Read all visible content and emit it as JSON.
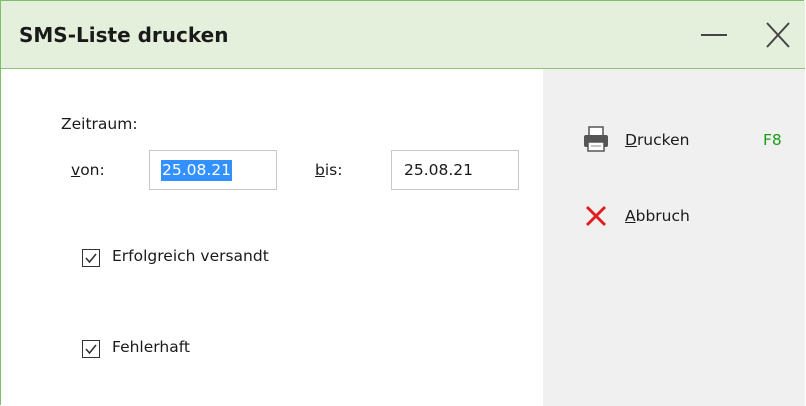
{
  "window": {
    "title": "SMS-Liste drucken",
    "controls": {
      "minimize": "minimize-icon",
      "close": "close-icon"
    }
  },
  "zeitraum": {
    "heading": "Zeitraum:",
    "from": {
      "label_accel": "v",
      "label_rest": "on:",
      "value": "25.08.21",
      "selected": true
    },
    "to": {
      "label_accel": "b",
      "label_rest": "is:",
      "value": "25.08.21"
    }
  },
  "options": [
    {
      "label": "Erfolgreich versandt",
      "checked": true
    },
    {
      "label": "Fehlerhaft",
      "checked": true
    }
  ],
  "actions": {
    "print": {
      "accel": "D",
      "rest": "rucken",
      "shortcut": "F8",
      "icon": "printer-icon"
    },
    "cancel": {
      "accel": "A",
      "rest": "bbruch",
      "icon": "red-x-icon"
    }
  },
  "colors": {
    "titlebar_bg": "#e4f0dc",
    "window_border": "#7dbf6a",
    "selection": "#3390ff",
    "shortcut": "#1a9e1a",
    "cancel_x": "#e02020",
    "right_pane_bg": "#f0f0f0"
  }
}
